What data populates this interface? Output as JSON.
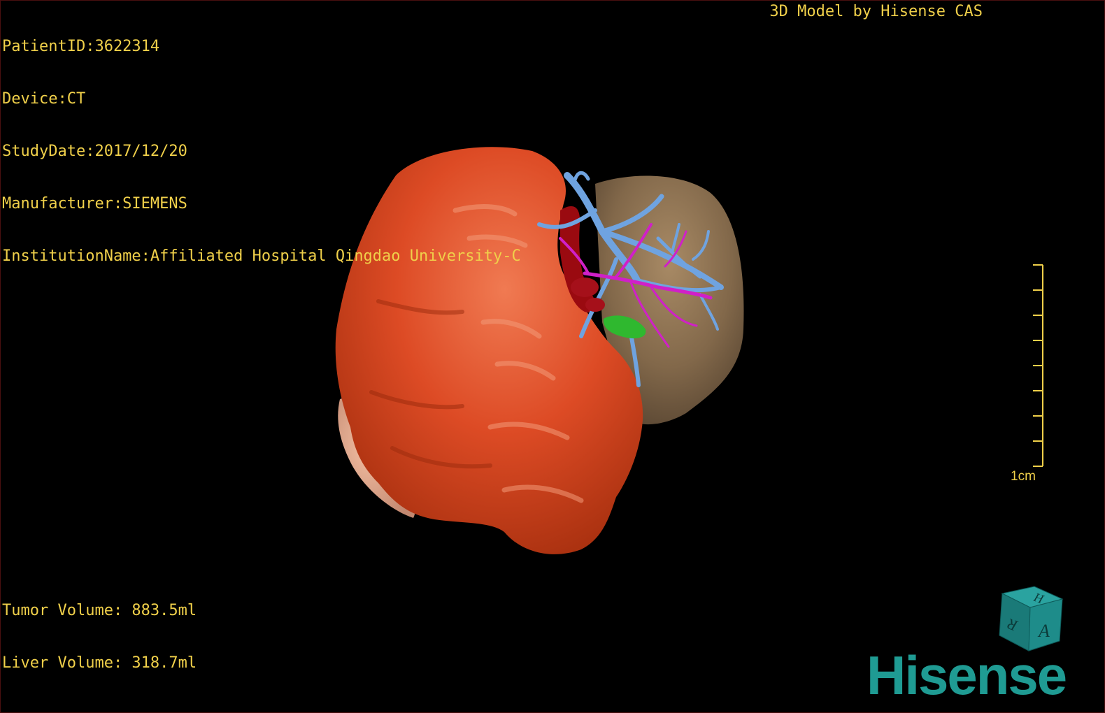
{
  "header": {
    "patient_id": "PatientID:3622314",
    "device": "Device:CT",
    "study_date": "StudyDate:2017/12/20",
    "manufacturer": "Manufacturer:SIEMENS",
    "institution": "InstitutionName:Affiliated Hospital Qingdao University-C"
  },
  "credit": "3D Model by Hisense CAS",
  "volumes": {
    "tumor": "Tumor Volume: 883.5ml",
    "liver": "Liver Volume: 318.7ml"
  },
  "scale_bar": {
    "label": "1cm",
    "ticks": 9
  },
  "orientation_cube": {
    "top_letter": "H",
    "left_letter": "R",
    "front_letter": "A",
    "color": "#1e8c8a"
  },
  "logo": {
    "text": "Hisense",
    "color": "#1f9b93"
  },
  "colors": {
    "text": "#f0d04a",
    "tumor": "#e0502a",
    "liver": "#8a7050",
    "portal_vein": "#6fa3e0",
    "hepatic_artery": "#d020c8",
    "gallbladder": "#2fb82f",
    "ivc": "#9a0a10"
  }
}
